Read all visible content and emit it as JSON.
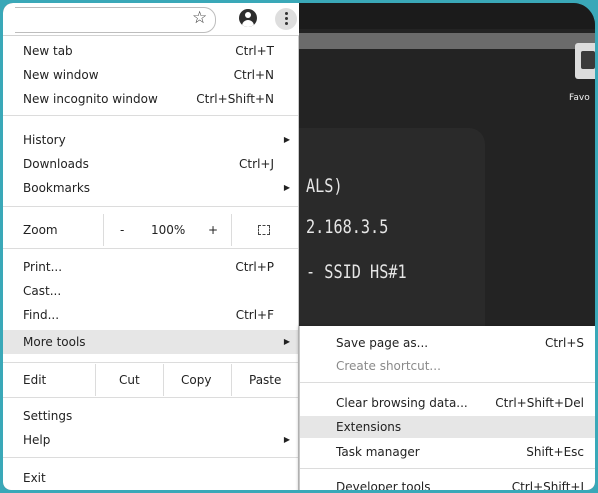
{
  "background": {
    "text_lines": [
      "ALS)",
      "2.168.3.5",
      "- SSID HS#1"
    ],
    "favorites_label": "Favo"
  },
  "toolbar": {
    "bookmark_icon": "star-icon",
    "account_icon": "account-circle-icon",
    "menu_icon": "kebab-menu-icon"
  },
  "menu": {
    "new_tab": {
      "label": "New tab",
      "shortcut": "Ctrl+T"
    },
    "new_window": {
      "label": "New window",
      "shortcut": "Ctrl+N"
    },
    "new_incognito": {
      "label": "New incognito window",
      "shortcut": "Ctrl+Shift+N"
    },
    "history": {
      "label": "History"
    },
    "downloads": {
      "label": "Downloads",
      "shortcut": "Ctrl+J"
    },
    "bookmarks": {
      "label": "Bookmarks"
    },
    "zoom": {
      "label": "Zoom",
      "minus": "-",
      "value": "100%",
      "plus": "+"
    },
    "print": {
      "label": "Print...",
      "shortcut": "Ctrl+P"
    },
    "cast": {
      "label": "Cast..."
    },
    "find": {
      "label": "Find...",
      "shortcut": "Ctrl+F"
    },
    "more_tools": {
      "label": "More tools"
    },
    "edit": {
      "label": "Edit",
      "cut": "Cut",
      "copy": "Copy",
      "paste": "Paste"
    },
    "settings": {
      "label": "Settings"
    },
    "help": {
      "label": "Help"
    },
    "exit": {
      "label": "Exit"
    }
  },
  "submenu": {
    "save_page": {
      "label": "Save page as...",
      "shortcut": "Ctrl+S"
    },
    "create_shortcut": {
      "label": "Create shortcut..."
    },
    "clear_data": {
      "label": "Clear browsing data...",
      "shortcut": "Ctrl+Shift+Del"
    },
    "extensions": {
      "label": "Extensions"
    },
    "task_manager": {
      "label": "Task manager",
      "shortcut": "Shift+Esc"
    },
    "developer_tools": {
      "label": "Developer tools",
      "shortcut": "Ctrl+Shift+I"
    }
  },
  "colors": {
    "accent_frame": "#3aa8b8",
    "highlight": "#e6e6e6"
  }
}
